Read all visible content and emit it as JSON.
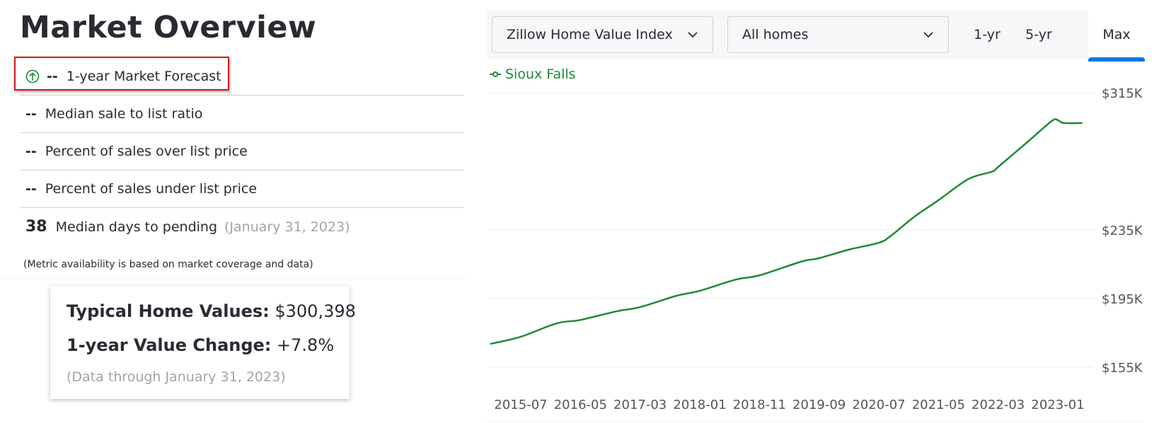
{
  "page": {
    "title": "Market Overview"
  },
  "metrics": [
    {
      "value": "--",
      "label": "1-year Market Forecast",
      "icon": "arrow-up-circle-icon",
      "highlighted": true
    },
    {
      "value": "--",
      "label": "Median sale to list ratio"
    },
    {
      "value": "--",
      "label": "Percent of sales over list price"
    },
    {
      "value": "--",
      "label": "Percent of sales under list price"
    },
    {
      "value": "38",
      "label": "Median days to pending",
      "date": "(January 31, 2023)"
    }
  ],
  "note": "(Metric availability is based on market coverage and data)",
  "summary_card": {
    "home_values_label": "Typical Home Values:",
    "home_values_value": "$300,398",
    "value_change_label": "1-year Value Change:",
    "value_change_value": "+7.8%",
    "data_through": "(Data through January 31, 2023)"
  },
  "controls": {
    "metric_select": {
      "selected": "Zillow Home Value Index",
      "icon": "chevron-down-icon"
    },
    "home_type_select": {
      "selected": "All homes",
      "icon": "chevron-down-icon"
    },
    "ranges": [
      {
        "label": "1-yr",
        "active": false
      },
      {
        "label": "5-yr",
        "active": false
      },
      {
        "label": "Max",
        "active": true
      }
    ],
    "active_color": "#1277e1"
  },
  "colors": {
    "series": "#1d8a35",
    "highlight_border": "#d4161c"
  },
  "chart_data": {
    "type": "line",
    "title": "",
    "xlabel": "",
    "ylabel": "",
    "legend": {
      "position": "top-left",
      "entries": [
        "Sioux Falls"
      ]
    },
    "grid": true,
    "y_axis_position": "right",
    "ylim": [
      155000,
      315000
    ],
    "y_ticks": [
      {
        "value": 315000,
        "label": "$315K"
      },
      {
        "value": 235000,
        "label": "$235K"
      },
      {
        "value": 195000,
        "label": "$195K"
      },
      {
        "value": 155000,
        "label": "$155K"
      }
    ],
    "x_ticks": [
      "2015-07",
      "2016-05",
      "2017-03",
      "2018-01",
      "2018-11",
      "2019-09",
      "2020-07",
      "2021-05",
      "2022-03",
      "2023-01"
    ],
    "xlim": [
      "2015-02",
      "2023-01"
    ],
    "series": [
      {
        "name": "Sioux Falls",
        "color": "#1d8a35",
        "points": [
          {
            "x": "2015-02",
            "y": 168600
          },
          {
            "x": "2015-07",
            "y": 172700
          },
          {
            "x": "2016-01",
            "y": 180500
          },
          {
            "x": "2016-05",
            "y": 182500
          },
          {
            "x": "2016-11",
            "y": 187500
          },
          {
            "x": "2017-03",
            "y": 190000
          },
          {
            "x": "2017-09",
            "y": 196500
          },
          {
            "x": "2018-01",
            "y": 199500
          },
          {
            "x": "2018-07",
            "y": 206000
          },
          {
            "x": "2018-11",
            "y": 208500
          },
          {
            "x": "2019-06",
            "y": 216500
          },
          {
            "x": "2019-09",
            "y": 218500
          },
          {
            "x": "2020-02",
            "y": 223500
          },
          {
            "x": "2020-07",
            "y": 227500
          },
          {
            "x": "2020-09",
            "y": 231500
          },
          {
            "x": "2021-01",
            "y": 242800
          },
          {
            "x": "2021-05",
            "y": 252300
          },
          {
            "x": "2021-10",
            "y": 264600
          },
          {
            "x": "2022-02",
            "y": 269000
          },
          {
            "x": "2022-03",
            "y": 271700
          },
          {
            "x": "2022-08",
            "y": 286500
          },
          {
            "x": "2022-12",
            "y": 298500
          },
          {
            "x": "2023-01",
            "y": 299000
          },
          {
            "x": "2023-02",
            "y": 297300
          },
          {
            "x": "2023-05",
            "y": 297300
          }
        ]
      }
    ]
  }
}
